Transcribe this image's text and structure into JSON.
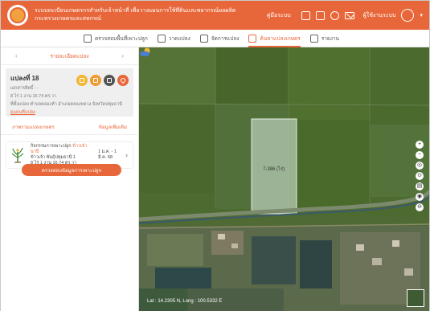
{
  "header": {
    "title_line1": "ระบบทะเบียนเกษตรกรสำหรับเจ้าหน้าที่ เพื่อวางแผนการใช้ที่ดินและพยากรณ์ผลผลิต",
    "title_line2": "กระทรวงเกษตรและสหกรณ์",
    "link_label": "คู่มือระบบ",
    "user_label": "ผู้ใช้งานระบบ",
    "icons": [
      "document-icon",
      "file-icon",
      "help-icon",
      "mail-icon",
      "user-icon"
    ]
  },
  "nav": {
    "items": [
      {
        "label": "ตรวจสอบพื้นที่เพาะปลูก",
        "icon": "map-pin-icon",
        "active": false
      },
      {
        "label": "วาดแปลง",
        "icon": "pencil-icon",
        "active": false
      },
      {
        "label": "จัดการแปลง",
        "icon": "grid-icon",
        "active": false
      },
      {
        "label": "ค้นหาแปลงเกษตร",
        "icon": "home-icon",
        "active": true
      },
      {
        "label": "รายงาน",
        "icon": "report-icon",
        "active": false
      }
    ]
  },
  "panel": {
    "prev": "‹",
    "next": "›",
    "title": "รายละเอียดแปลง",
    "plot": {
      "name": "แปลงที่ 18",
      "line1": "เอกสารสิทธิ์ : -",
      "line2": "8 ไร่ 1 งาน 16.74 ตร.วา",
      "line3": "ที่ตั้งแปลง ตำบลคลองห้า อำเภอคลองหลวง จังหวัดปทุมธานี",
      "link": "ดูแผนที่แปลง"
    },
    "actions": [
      {
        "name": "farmer-icon",
        "color": "#f2b634"
      },
      {
        "name": "document-icon",
        "color": "#f09a32"
      },
      {
        "name": "calendar-icon",
        "color": "#555555"
      },
      {
        "name": "location-icon",
        "color": "#e8673a"
      }
    ],
    "tabs": [
      "ภาพรวมแปลงเกษตร",
      "ข้อมูลเพิ่มเติม"
    ],
    "crop": {
      "prefix": "กิจกรรมการเพาะปลูก",
      "highlight": "ข้าวเจ้านาปี",
      "line2": "ข้าวเจ้า พันธุ์ปทุมธานี 1",
      "line3": "8 ไร่ 1 งาน 16.74 ตร.วา",
      "date": "1 ม.ค. - 1 มี.ค. 68"
    },
    "cta_label": "ตรวจสอบข้อมูลการเพาะปลูก"
  },
  "map": {
    "plot_label": "7-386 (ไร่)",
    "coordinates": "Lat : 14.2305 N, Long : 100.5332 E",
    "tools": [
      "+",
      "−",
      "◎",
      "⊙",
      "▤",
      "◉",
      "⊖"
    ]
  }
}
